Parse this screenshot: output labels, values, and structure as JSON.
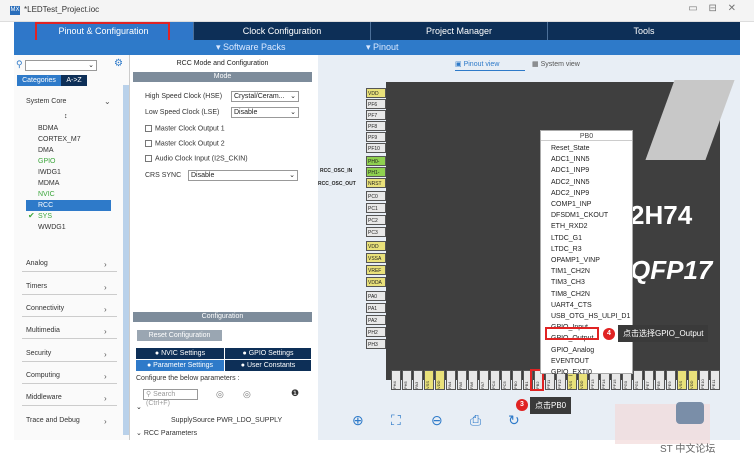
{
  "window": {
    "title": "*LEDTest_Project.ioc",
    "controls": "▭ ⊟ ✕"
  },
  "tabs": [
    "Pinout & Configuration",
    "Clock Configuration",
    "Project Manager",
    "Tools"
  ],
  "subbar": {
    "software_packs": "Software Packs",
    "pinout": "Pinout"
  },
  "left": {
    "category_tabs": [
      "Categories",
      "A->Z"
    ],
    "system_core": "System Core",
    "system_items": [
      "BDMA",
      "CORTEX_M7",
      "DMA",
      "GPIO",
      "IWDG1",
      "MDMA",
      "NVIC",
      "RCC",
      "SYS",
      "WWDG1"
    ],
    "categories": [
      "Analog",
      "Timers",
      "Connectivity",
      "Multimedia",
      "Security",
      "Computing",
      "Middleware",
      "Trace and Debug"
    ]
  },
  "mid": {
    "header": "RCC Mode and Configuration",
    "mode": "Mode",
    "hse_label": "High Speed Clock (HSE)",
    "hse_value": "Crystal/Ceram...",
    "lse_label": "Low Speed Clock (LSE)",
    "lse_value": "Disable",
    "mco1": "Master Clock Output 1",
    "mco2": "Master Clock Output 2",
    "aci": "Audio Clock Input (I2S_CKIN)",
    "crs_label": "CRS SYNC",
    "crs_value": "Disable",
    "configuration": "Configuration",
    "reset_btn": "Reset Configuration",
    "nvic": "NVIC Settings",
    "gpio": "GPIO Settings",
    "param": "Parameter Settings",
    "user": "User Constants",
    "configure_text": "Configure the below parameters :",
    "search_ph": "Search (Ctrl+F)",
    "supply_label": "SupplySource",
    "supply_value": "PWR_LDO_SUPPLY",
    "rcc_params": "RCC Parameters"
  },
  "pinview": {
    "pinout_view": "Pinout view",
    "system_view": "System view",
    "left_pins": [
      "VDD",
      "PF6",
      "PF7",
      "PF8",
      "PF9",
      "PF10",
      "PH0-",
      "PH1-",
      "NRST",
      "PC0",
      "PC1",
      "PC2",
      "PC3",
      "VDD",
      "VSSA",
      "VREF",
      "VDDA",
      "PA0",
      "PA1",
      "PA2",
      "PH2",
      "PH3"
    ],
    "bottom_pins": [
      "PH4",
      "PH5",
      "PA3",
      "VSS",
      "VDD",
      "PA4",
      "PA5",
      "PA6",
      "PA7",
      "PC4",
      "PC5",
      "PB0",
      "PB1",
      "PB2",
      "PF11",
      "PF12",
      "VSS",
      "VDD",
      "PF13",
      "PF14",
      "PF15",
      "PG0",
      "PG1",
      "PE7",
      "PE8",
      "PE9",
      "VSS",
      "VDD",
      "PE10",
      "PE11"
    ],
    "osc_in": "RCC_OSC_IN",
    "osc_out": "RCC_OSC_OUT",
    "chip_text1": "2H74",
    "chip_text2": "QFP17"
  },
  "menu": {
    "title": "PB0",
    "items": [
      "Reset_State",
      "ADC1_INN5",
      "ADC1_INP9",
      "ADC2_INN5",
      "ADC2_INP9",
      "COMP1_INP",
      "DFSDM1_CKOUT",
      "ETH_RXD2",
      "LTDC_G1",
      "LTDC_R3",
      "OPAMP1_VINP",
      "TIM1_CH2N",
      "TIM3_CH3",
      "TIM8_CH2N",
      "UART4_CTS",
      "USB_OTG_HS_ULPI_D1",
      "GPIO_Input",
      "GPIO_Output",
      "GPIO_Analog",
      "EVENTOUT",
      "GPIO_EXTI0"
    ]
  },
  "annotations": {
    "b1": "1",
    "b3": "3",
    "b4": "4",
    "click_pb0": "点击PB0",
    "choose_gpio": "点击选择GPIO_Output"
  },
  "watermark": "ST 中文论坛"
}
